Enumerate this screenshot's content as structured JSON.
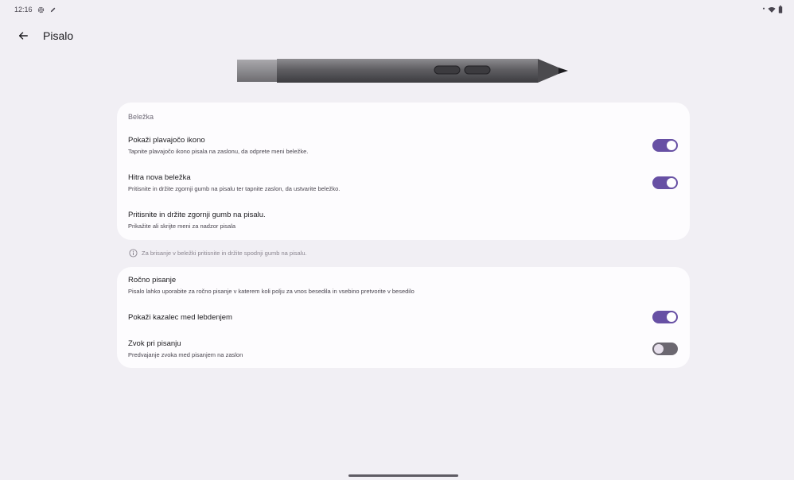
{
  "status_bar": {
    "time": "12:16",
    "icons": [
      "settings-gear-icon",
      "pencil-icon",
      "signal-dot-icon",
      "wifi-icon",
      "battery-icon"
    ]
  },
  "app_bar": {
    "title": "Pisalo",
    "back_icon": "arrow-back-icon"
  },
  "colors": {
    "background": "#f1eff4",
    "card": "#fdfcfe",
    "accent": "#6750a4",
    "switch_off": "#6b6770"
  },
  "sections": [
    {
      "header": "Beležka",
      "items": [
        {
          "title": "Pokaži plavajočo ikono",
          "subtitle": "Tapnite plavajočo ikono pisala na zaslonu, da odprete meni beležke.",
          "toggle": true
        },
        {
          "title": "Hitra nova beležka",
          "subtitle": "Pritisnite in držite zgornji gumb na pisalu ter tapnite zaslon, da ustvarite beležko.",
          "toggle": true
        },
        {
          "title": "Pritisnite in držite zgornji gumb na pisalu.",
          "subtitle": "Prikažite ali skrijte meni za nadzor pisala"
        }
      ]
    },
    {
      "items": [
        {
          "title": "Ročno pisanje",
          "subtitle": "Pisalo lahko uporabite za ročno pisanje v katerem koli polju za vnos besedila in vsebino pretvorite v besedilo"
        },
        {
          "title": "Pokaži kazalec med lebdenjem",
          "toggle": true
        },
        {
          "title": "Zvok pri pisanju",
          "subtitle": "Predvajanje zvoka med pisanjem na zaslon",
          "toggle": false
        }
      ]
    }
  ],
  "info_note": {
    "icon": "info-icon",
    "text": "Za brisanje v beležki pritisnite in držite spodnji gumb na pisalu."
  }
}
